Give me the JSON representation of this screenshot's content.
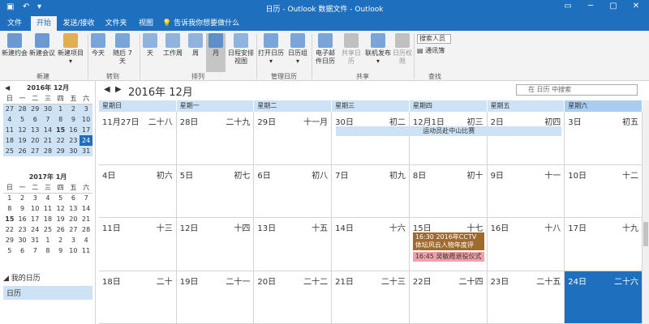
{
  "app": {
    "title": "日历 - Outlook 数据文件 - Outlook",
    "tell_me": "告诉我你想要做什么"
  },
  "tabs": [
    "文件",
    "开始",
    "发送/接收",
    "文件夹",
    "视图"
  ],
  "ribbon": {
    "new_group": "新建",
    "new_appt": "新建约会",
    "new_meeting": "新建会议",
    "new_items": "新建项目",
    "goto_group": "转到",
    "today": "今天",
    "next7": "随后 7 天",
    "arrange_group": "排列",
    "day": "天",
    "work_week": "工作周",
    "week": "周",
    "month": "月",
    "schedule": "日程安排视图",
    "manage_group": "管理日历",
    "open_cal": "打开日历",
    "cal_groups": "日历组",
    "share_group": "共享",
    "email_cal": "电子邮件日历",
    "share_cal": "共享日历",
    "publish": "联机发布",
    "perm": "日历权限",
    "find_group": "查找",
    "search_people": "搜索人员",
    "address_book": "通讯簿"
  },
  "mini1": {
    "title": "2016年 12月",
    "wd": [
      "日",
      "一",
      "二",
      "三",
      "四",
      "五",
      "六"
    ],
    "weeks": [
      [
        "27",
        "28",
        "29",
        "30",
        "1",
        "2",
        "3"
      ],
      [
        "4",
        "5",
        "6",
        "7",
        "8",
        "9",
        "10"
      ],
      [
        "11",
        "12",
        "13",
        "14",
        "15",
        "16",
        "17"
      ],
      [
        "18",
        "19",
        "20",
        "21",
        "22",
        "23",
        "24"
      ],
      [
        "25",
        "26",
        "27",
        "28",
        "29",
        "30",
        "31"
      ]
    ]
  },
  "mini2": {
    "title": "2017年 1月",
    "wd": [
      "日",
      "一",
      "二",
      "三",
      "四",
      "五",
      "六"
    ],
    "weeks": [
      [
        "1",
        "2",
        "3",
        "4",
        "5",
        "6",
        "7"
      ],
      [
        "8",
        "9",
        "10",
        "11",
        "12",
        "13",
        "14"
      ],
      [
        "15",
        "16",
        "17",
        "18",
        "19",
        "20",
        "21"
      ],
      [
        "22",
        "23",
        "24",
        "25",
        "26",
        "27",
        "28"
      ],
      [
        "29",
        "30",
        "31",
        "1",
        "2",
        "3",
        "4"
      ],
      [
        "5",
        "6",
        "7",
        "8",
        "9",
        "10",
        "11"
      ]
    ]
  },
  "folder": {
    "header": "我的日历",
    "item": "日历"
  },
  "cal": {
    "title": "2016年 12月",
    "search": "在 日历 中搜索",
    "weekdays": [
      "星期日",
      "星期一",
      "星期二",
      "星期三",
      "星期四",
      "星期五",
      "星期六"
    ],
    "weeks": [
      [
        [
          "11月27日",
          "二十八"
        ],
        [
          "28日",
          "二十九"
        ],
        [
          "29日",
          "十一月"
        ],
        [
          "30日",
          "初二"
        ],
        [
          "12月1日",
          "初三"
        ],
        [
          "2日",
          "初四"
        ],
        [
          "3日",
          "初五"
        ]
      ],
      [
        [
          "4日",
          "初六"
        ],
        [
          "5日",
          "初七"
        ],
        [
          "6日",
          "初八"
        ],
        [
          "7日",
          "初九"
        ],
        [
          "8日",
          "初十"
        ],
        [
          "9日",
          "十一"
        ],
        [
          "10日",
          "十二"
        ]
      ],
      [
        [
          "11日",
          "十三"
        ],
        [
          "12日",
          "十四"
        ],
        [
          "13日",
          "十五"
        ],
        [
          "14日",
          "十六"
        ],
        [
          "15日",
          "十七"
        ],
        [
          "16日",
          "十八"
        ],
        [
          "17日",
          "十九"
        ]
      ],
      [
        [
          "18日",
          "二十"
        ],
        [
          "19日",
          "二十一"
        ],
        [
          "20日",
          "二十二"
        ],
        [
          "21日",
          "二十三"
        ],
        [
          "22日",
          "二十四"
        ],
        [
          "23日",
          "二十五"
        ],
        [
          "24日",
          "二十六"
        ]
      ]
    ],
    "events": {
      "e1": "运动员赴中山比赛",
      "e2": "16:30 2016年CCTV体坛风云人物年度评选...",
      "e3": "16:45 吴敏霞退役仪式"
    },
    "colors": {
      "e1": "#cde3f5",
      "e2": "#a0692d",
      "e3": "#f0a0a8"
    }
  }
}
